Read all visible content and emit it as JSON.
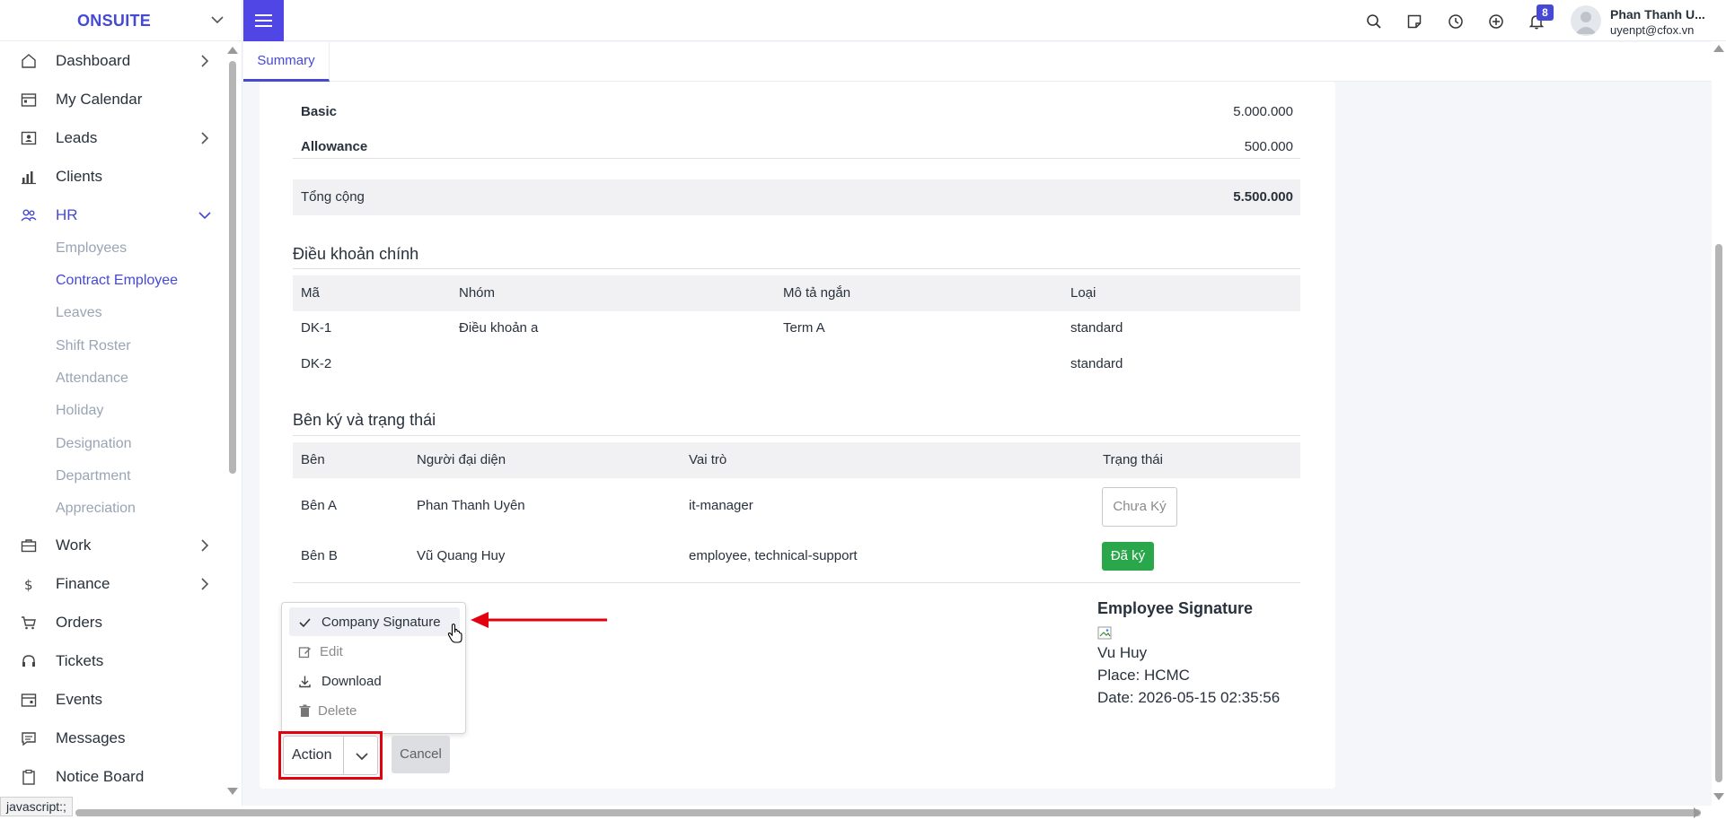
{
  "brand": {
    "name": "ONSUITE"
  },
  "sidebar": {
    "items": [
      {
        "label": "Dashboard",
        "icon": "house-icon",
        "has_chevron": true
      },
      {
        "label": "My Calendar",
        "icon": "calendar-icon",
        "has_chevron": false
      },
      {
        "label": "Leads",
        "icon": "contact-card-icon",
        "has_chevron": true
      },
      {
        "label": "Clients",
        "icon": "bar-chart-icon",
        "has_chevron": false
      },
      {
        "label": "HR",
        "icon": "people-icon",
        "has_chevron": true,
        "expanded": true
      },
      {
        "label": "Work",
        "icon": "briefcase-icon",
        "has_chevron": true
      },
      {
        "label": "Finance",
        "icon": "dollar-icon",
        "has_chevron": true
      },
      {
        "label": "Orders",
        "icon": "cart-icon",
        "has_chevron": false
      },
      {
        "label": "Tickets",
        "icon": "headset-icon",
        "has_chevron": false
      },
      {
        "label": "Events",
        "icon": "calendar-event-icon",
        "has_chevron": false
      },
      {
        "label": "Messages",
        "icon": "chat-icon",
        "has_chevron": false
      },
      {
        "label": "Notice Board",
        "icon": "clipboard-icon",
        "has_chevron": false
      }
    ],
    "hr_subitems": [
      "Employees",
      "Contract Employee",
      "Leaves",
      "Shift Roster",
      "Attendance",
      "Holiday",
      "Designation",
      "Department",
      "Appreciation"
    ],
    "active_subitem": "Contract Employee"
  },
  "topbar": {
    "notification_count": "8",
    "user_name": "Phan Thanh U...",
    "user_email": "uyenpt@cfox.vn"
  },
  "tabs": [
    {
      "label": "Summary",
      "active": true
    }
  ],
  "salary": {
    "rows": [
      {
        "label": "Basic",
        "value": "5.000.000"
      },
      {
        "label": "Allowance",
        "value": "500.000"
      }
    ],
    "total_label": "Tổng cộng",
    "total_value": "5.500.000"
  },
  "terms": {
    "title": "Điều khoản chính",
    "headers": [
      "Mã",
      "Nhóm",
      "Mô tả ngắn",
      "Loại"
    ],
    "rows": [
      [
        "DK-1",
        "Điều khoản a",
        "Term A",
        "standard"
      ],
      [
        "DK-2",
        "",
        "",
        "standard"
      ]
    ]
  },
  "signers": {
    "title": "Bên ký và trạng thái",
    "headers": [
      "Bên",
      "Người đại diện",
      "Vai trò",
      "Trạng thái"
    ],
    "rows": [
      {
        "party": "Bên A",
        "representative": "Phan Thanh Uyên",
        "role": "it-manager",
        "status": "Chưa Ký"
      },
      {
        "party": "Bên B",
        "representative": "Vũ Quang Huy",
        "role": "employee, technical-support",
        "status": "Đã ký"
      }
    ]
  },
  "employee_signature": {
    "title": "Employee Signature",
    "name": "Vu Huy",
    "place": "Place: HCMC",
    "date": "Date: 2026-05-15 02:35:56"
  },
  "action_menu": {
    "items": [
      {
        "label": "Company Signature",
        "icon": "check-icon",
        "highlighted": true
      },
      {
        "label": "Edit",
        "icon": "edit-icon",
        "muted": true
      },
      {
        "label": "Download",
        "icon": "download-icon"
      },
      {
        "label": "Delete",
        "icon": "trash-icon",
        "muted": true
      }
    ],
    "action_label": "Action",
    "cancel_label": "Cancel"
  },
  "status_bar": {
    "text": "javascript:;"
  },
  "colors": {
    "accent": "#4649d6",
    "success": "#2aa74a",
    "highlight": "#e3000f"
  }
}
